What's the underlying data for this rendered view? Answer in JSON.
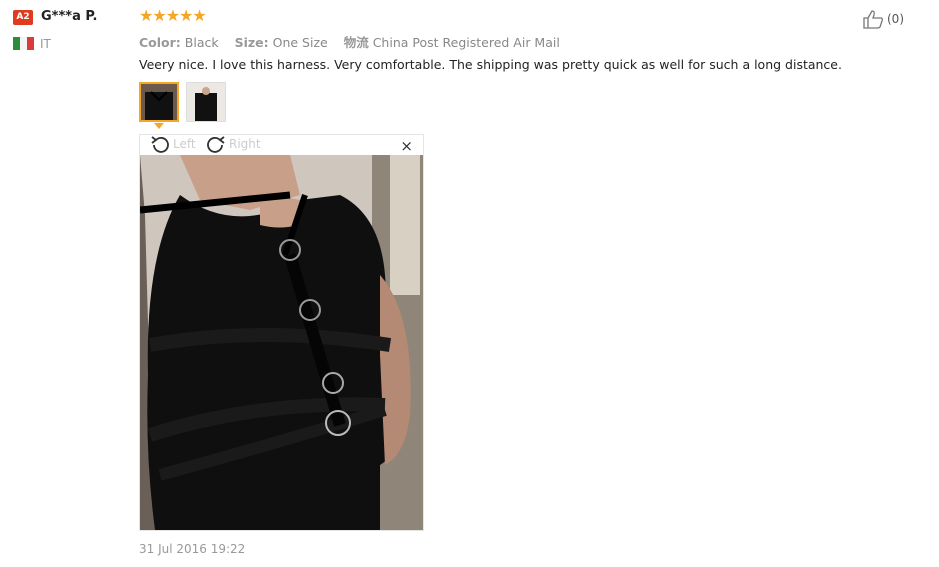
{
  "reviewer": {
    "badge": "A2",
    "name": "G***a P.",
    "country": "IT"
  },
  "rating": {
    "stars": 5,
    "star_color": "#f5a623"
  },
  "meta": {
    "color_label": "Color:",
    "color_value": "Black",
    "size_label": "Size:",
    "size_value": "One Size",
    "shipping_label": "物流",
    "shipping_value": "China Post Registered Air Mail"
  },
  "review_text": "Veery nice. I love this harness. Very comfortable. The shipping was pretty quick as well for such a long distance.",
  "thumbnails": [
    {
      "active": true
    },
    {
      "active": false
    }
  ],
  "viewer": {
    "rotate_left_label": "Left",
    "rotate_right_label": "Right",
    "close_symbol": "×"
  },
  "like": {
    "count": "(0)"
  },
  "date": "31 Jul 2016 19:22"
}
